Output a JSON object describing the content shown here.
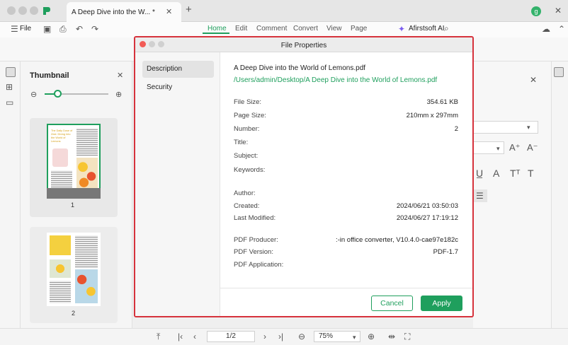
{
  "window": {
    "tab_title": "A Deep Dive into the W... *",
    "avatar_letter": "g"
  },
  "toolbar": {
    "file_label": "File",
    "menu": [
      "Home",
      "Edit",
      "Comment",
      "Convert",
      "View",
      "Page"
    ],
    "ai_label": "Afirstsoft AI"
  },
  "thumbnail": {
    "title": "Thumbnail",
    "zoom_fraction": 0.2,
    "pages": [
      {
        "number": "1",
        "heading": "The Daily Dose of Zest: Diving Into the World of Lemons"
      },
      {
        "number": "2"
      }
    ]
  },
  "bottom": {
    "page_indicator": "1/2",
    "zoom": "75%"
  },
  "dialog": {
    "title": "File Properties",
    "tabs": [
      "Description",
      "Security"
    ],
    "active_tab": "Description",
    "file_name": "A Deep Dive into the World of Lemons.pdf",
    "file_path": "/Users/admin/Desktop/A Deep Dive into the World of Lemons.pdf",
    "properties": [
      {
        "label": "File Size:",
        "value": "354.61 KB"
      },
      {
        "label": "Page Size:",
        "value": "210mm x 297mm"
      },
      {
        "label": "Number:",
        "value": "2"
      },
      {
        "label": "Title:",
        "value": ""
      },
      {
        "label": "Subject:",
        "value": ""
      },
      {
        "label": "Keywords:",
        "value": ""
      },
      {
        "label": "Author:",
        "value": ""
      },
      {
        "label": "Created:",
        "value": "2024/06/21 03:50:03"
      },
      {
        "label": "Last Modified:",
        "value": "2024/06/27 17:19:12"
      },
      {
        "label": "PDF Producer:",
        "value": ":-in office converter, V10.4.0-cae97e182c"
      },
      {
        "label": "PDF Version:",
        "value": "PDF-1.7"
      },
      {
        "label": "PDF Application:",
        "value": ""
      }
    ],
    "cancel_label": "Cancel",
    "apply_label": "Apply"
  },
  "colors": {
    "accent": "#1f9f5d",
    "highlight_border": "#d6323c"
  }
}
